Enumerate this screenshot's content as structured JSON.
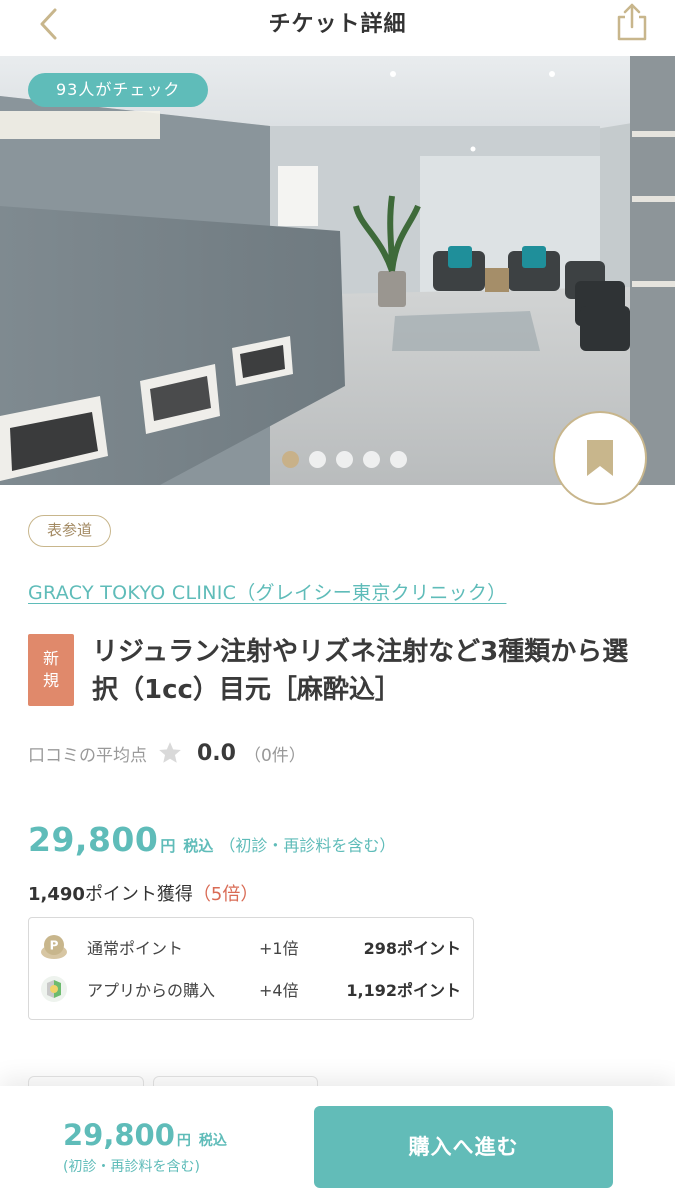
{
  "header": {
    "title": "チケット詳細",
    "back_icon": "chevron-left-icon",
    "share_icon": "share-icon"
  },
  "hero": {
    "check_badge": "93人がチェック",
    "image_description_icon": "clinic-photo",
    "slides_total": 5,
    "slide_active": 1,
    "bookmark_icon": "bookmark-icon"
  },
  "ticket": {
    "area_tag": "表参道",
    "clinic_name": "GRACY TOKYO CLINIC（グレイシー東京クリニック）",
    "new_badge_line1": "新",
    "new_badge_line2": "規",
    "title": "リジュラン注射やリズネ注射など3種類から選択（1cc）目元［麻酔込］"
  },
  "reviews": {
    "label": "口コミの平均点",
    "score": "0.0",
    "count": "（0件）"
  },
  "price": {
    "value": "29,800",
    "unit": "円",
    "tax": "税込",
    "note": "（初診・再診料を含む）"
  },
  "points": {
    "earn_num": "1,490",
    "earn_text": "ポイント獲得",
    "earn_mult": "（5倍）",
    "rows": [
      {
        "icon": "point-coin-icon",
        "label": "通常ポイント",
        "mult": "+1倍",
        "pts": "298ポイント"
      },
      {
        "icon": "app-purchase-icon",
        "label": "アプリからの購入",
        "mult": "+4倍",
        "pts": "1,192ポイント"
      }
    ]
  },
  "footer": {
    "price_value": "29,800",
    "price_unit": "円",
    "price_tax": "税込",
    "price_note": "(初診・再診料を含む)",
    "buy_label": "購入へ進む"
  },
  "colors": {
    "accent": "#5fbcb9",
    "gold": "#c8b68c",
    "new_badge": "#e0896b",
    "multiplier": "#d96b55"
  }
}
